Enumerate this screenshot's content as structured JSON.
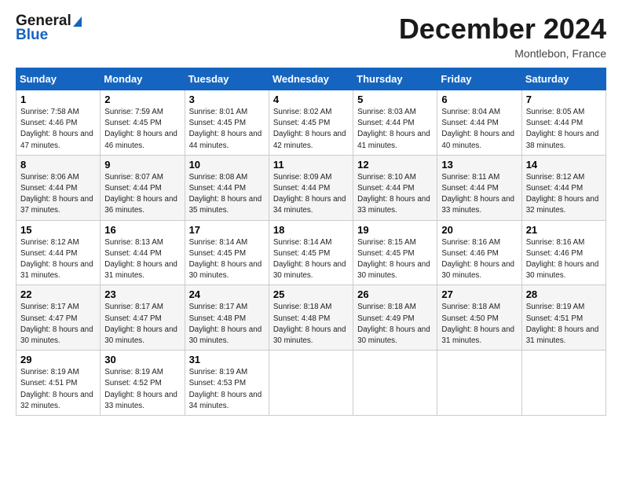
{
  "header": {
    "logo_line1": "General",
    "logo_line2": "Blue",
    "month": "December 2024",
    "location": "Montlebon, France"
  },
  "weekdays": [
    "Sunday",
    "Monday",
    "Tuesday",
    "Wednesday",
    "Thursday",
    "Friday",
    "Saturday"
  ],
  "weeks": [
    [
      {
        "day": "1",
        "rise": "7:58 AM",
        "set": "4:46 PM",
        "daylight": "8 hours and 47 minutes."
      },
      {
        "day": "2",
        "rise": "7:59 AM",
        "set": "4:45 PM",
        "daylight": "8 hours and 46 minutes."
      },
      {
        "day": "3",
        "rise": "8:01 AM",
        "set": "4:45 PM",
        "daylight": "8 hours and 44 minutes."
      },
      {
        "day": "4",
        "rise": "8:02 AM",
        "set": "4:45 PM",
        "daylight": "8 hours and 42 minutes."
      },
      {
        "day": "5",
        "rise": "8:03 AM",
        "set": "4:44 PM",
        "daylight": "8 hours and 41 minutes."
      },
      {
        "day": "6",
        "rise": "8:04 AM",
        "set": "4:44 PM",
        "daylight": "8 hours and 40 minutes."
      },
      {
        "day": "7",
        "rise": "8:05 AM",
        "set": "4:44 PM",
        "daylight": "8 hours and 38 minutes."
      }
    ],
    [
      {
        "day": "8",
        "rise": "8:06 AM",
        "set": "4:44 PM",
        "daylight": "8 hours and 37 minutes."
      },
      {
        "day": "9",
        "rise": "8:07 AM",
        "set": "4:44 PM",
        "daylight": "8 hours and 36 minutes."
      },
      {
        "day": "10",
        "rise": "8:08 AM",
        "set": "4:44 PM",
        "daylight": "8 hours and 35 minutes."
      },
      {
        "day": "11",
        "rise": "8:09 AM",
        "set": "4:44 PM",
        "daylight": "8 hours and 34 minutes."
      },
      {
        "day": "12",
        "rise": "8:10 AM",
        "set": "4:44 PM",
        "daylight": "8 hours and 33 minutes."
      },
      {
        "day": "13",
        "rise": "8:11 AM",
        "set": "4:44 PM",
        "daylight": "8 hours and 33 minutes."
      },
      {
        "day": "14",
        "rise": "8:12 AM",
        "set": "4:44 PM",
        "daylight": "8 hours and 32 minutes."
      }
    ],
    [
      {
        "day": "15",
        "rise": "8:12 AM",
        "set": "4:44 PM",
        "daylight": "8 hours and 31 minutes."
      },
      {
        "day": "16",
        "rise": "8:13 AM",
        "set": "4:44 PM",
        "daylight": "8 hours and 31 minutes."
      },
      {
        "day": "17",
        "rise": "8:14 AM",
        "set": "4:45 PM",
        "daylight": "8 hours and 30 minutes."
      },
      {
        "day": "18",
        "rise": "8:14 AM",
        "set": "4:45 PM",
        "daylight": "8 hours and 30 minutes."
      },
      {
        "day": "19",
        "rise": "8:15 AM",
        "set": "4:45 PM",
        "daylight": "8 hours and 30 minutes."
      },
      {
        "day": "20",
        "rise": "8:16 AM",
        "set": "4:46 PM",
        "daylight": "8 hours and 30 minutes."
      },
      {
        "day": "21",
        "rise": "8:16 AM",
        "set": "4:46 PM",
        "daylight": "8 hours and 30 minutes."
      }
    ],
    [
      {
        "day": "22",
        "rise": "8:17 AM",
        "set": "4:47 PM",
        "daylight": "8 hours and 30 minutes."
      },
      {
        "day": "23",
        "rise": "8:17 AM",
        "set": "4:47 PM",
        "daylight": "8 hours and 30 minutes."
      },
      {
        "day": "24",
        "rise": "8:17 AM",
        "set": "4:48 PM",
        "daylight": "8 hours and 30 minutes."
      },
      {
        "day": "25",
        "rise": "8:18 AM",
        "set": "4:48 PM",
        "daylight": "8 hours and 30 minutes."
      },
      {
        "day": "26",
        "rise": "8:18 AM",
        "set": "4:49 PM",
        "daylight": "8 hours and 30 minutes."
      },
      {
        "day": "27",
        "rise": "8:18 AM",
        "set": "4:50 PM",
        "daylight": "8 hours and 31 minutes."
      },
      {
        "day": "28",
        "rise": "8:19 AM",
        "set": "4:51 PM",
        "daylight": "8 hours and 31 minutes."
      }
    ],
    [
      {
        "day": "29",
        "rise": "8:19 AM",
        "set": "4:51 PM",
        "daylight": "8 hours and 32 minutes."
      },
      {
        "day": "30",
        "rise": "8:19 AM",
        "set": "4:52 PM",
        "daylight": "8 hours and 33 minutes."
      },
      {
        "day": "31",
        "rise": "8:19 AM",
        "set": "4:53 PM",
        "daylight": "8 hours and 34 minutes."
      },
      null,
      null,
      null,
      null
    ]
  ]
}
